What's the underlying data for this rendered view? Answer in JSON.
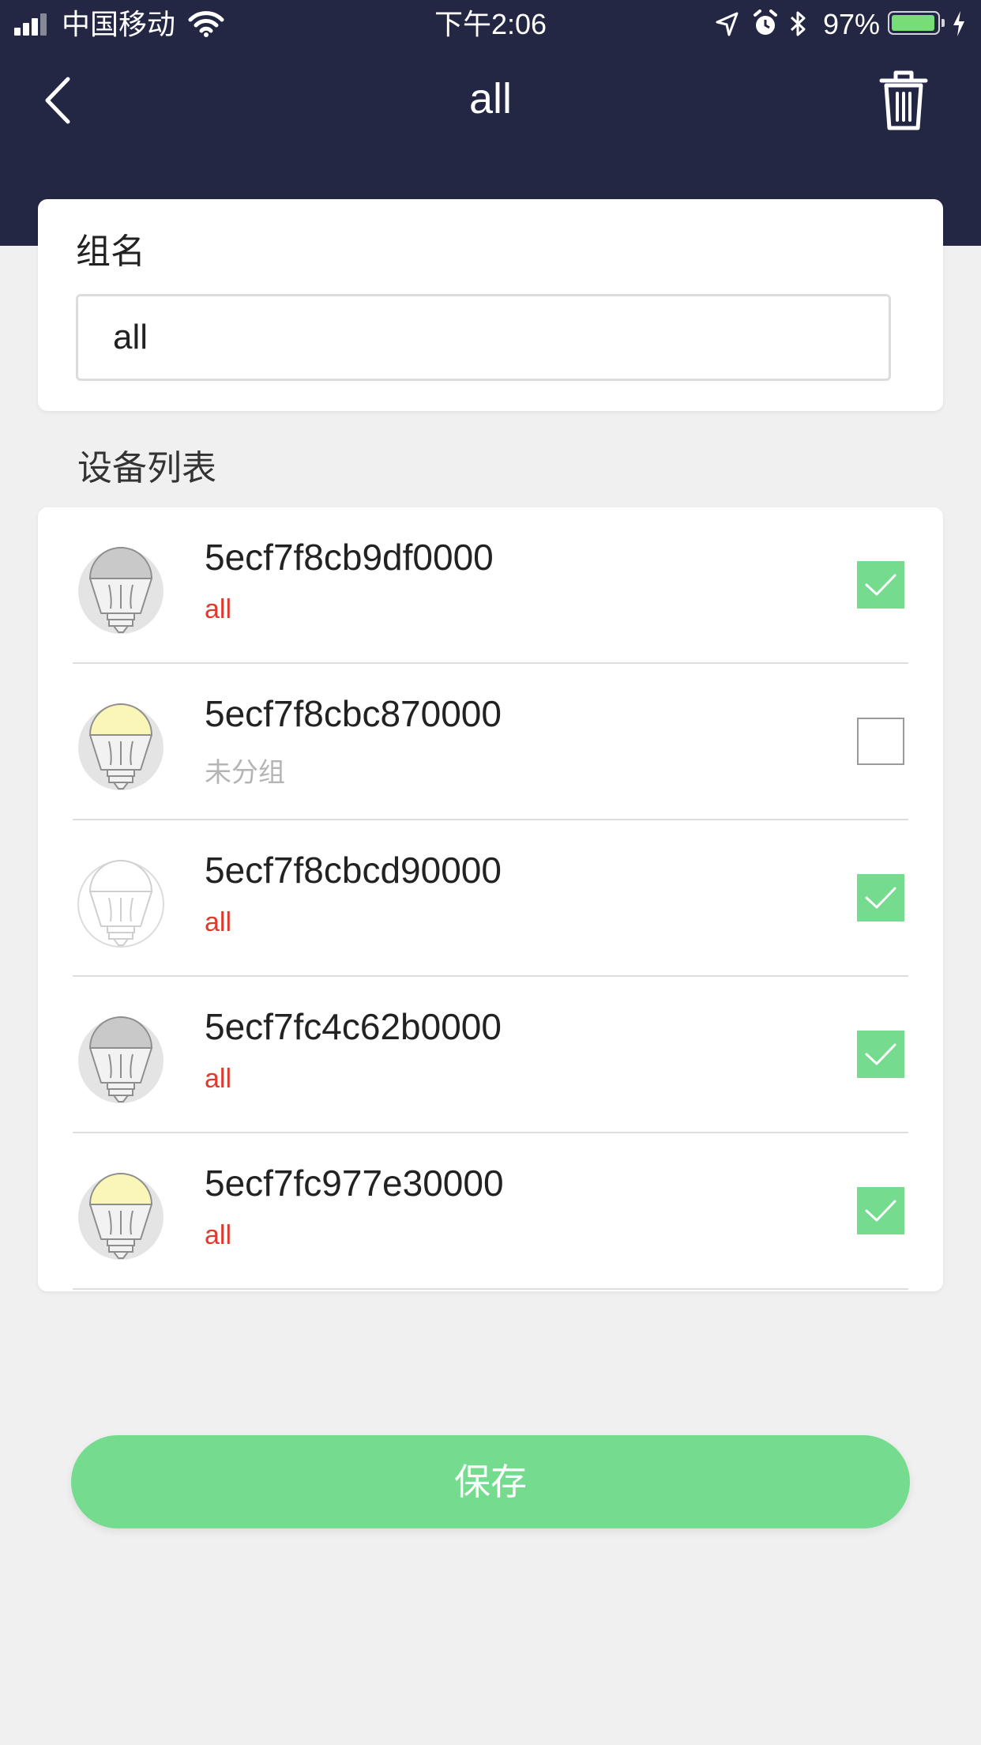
{
  "status_bar": {
    "carrier": "中国移动",
    "time": "下午2:06",
    "battery_percent_label": "97%",
    "battery_level": 0.97
  },
  "header": {
    "title": "all",
    "back_icon": "chevron-left-icon",
    "delete_icon": "trash-icon"
  },
  "group_form": {
    "label": "组名",
    "value": "all"
  },
  "device_section": {
    "title": "设备列表",
    "devices": [
      {
        "id": "5ecf7f8cb9df0000",
        "group": "all",
        "assigned": true,
        "checked": true,
        "bulb_state": "off"
      },
      {
        "id": "5ecf7f8cbc870000",
        "group": "未分组",
        "assigned": false,
        "checked": false,
        "bulb_state": "on"
      },
      {
        "id": "5ecf7f8cbcd90000",
        "group": "all",
        "assigned": true,
        "checked": true,
        "bulb_state": "offline"
      },
      {
        "id": "5ecf7fc4c62b0000",
        "group": "all",
        "assigned": true,
        "checked": true,
        "bulb_state": "off"
      },
      {
        "id": "5ecf7fc977e30000",
        "group": "all",
        "assigned": true,
        "checked": true,
        "bulb_state": "on"
      }
    ]
  },
  "actions": {
    "save_label": "保存"
  },
  "colors": {
    "header_bg": "#242744",
    "accent_green": "#75dc8f",
    "group_assigned": "#e03a2e",
    "group_unassigned": "#b5b5b5",
    "page_bg": "#f0f0f0"
  }
}
